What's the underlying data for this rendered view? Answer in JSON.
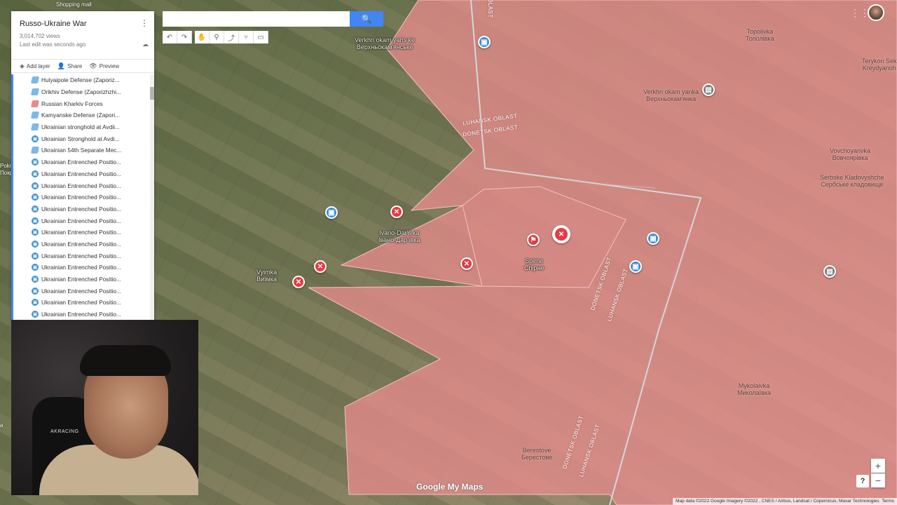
{
  "map": {
    "top_label": "Shopping mall",
    "places": [
      {
        "name": "Verkhn okam yans ke",
        "alt": "Верхньокам'янське"
      },
      {
        "name": "Verkhn okam yanka",
        "alt": "Верхньокам'янка"
      },
      {
        "name": "Topolivka",
        "alt": "Тополівка"
      },
      {
        "name": "Terykon Sek",
        "alt": "Kreydyanoh"
      },
      {
        "name": "Vovchoyarivka",
        "alt": "Вовчоярівка"
      },
      {
        "name": "Serbske Kladovyshche",
        "alt": "Сербське кладовище"
      },
      {
        "name": "Ivano-Dar'ivka",
        "alt": "Івано-Дар'ївка"
      },
      {
        "name": "Spirne",
        "alt": "Спірне"
      },
      {
        "name": "Vyimka",
        "alt": "Виїмка"
      },
      {
        "name": "Mykolaivka",
        "alt": "Миколаївка"
      },
      {
        "name": "Berestove",
        "alt": "Берестове"
      }
    ],
    "oblasts": {
      "luhansk": "LUHANSK OBLAST",
      "donetsk": "DONETSK OBLAST",
      "obl_short": "OBLAST"
    },
    "left_edge": {
      "a": "Pokr",
      "b": "Покр",
      "c": "a"
    },
    "colors": {
      "occupied": "#e58c8c",
      "border": "#d9dde2",
      "marker_red": "#e23d44",
      "marker_blue": "#3a8fd1"
    }
  },
  "search": {
    "placeholder": "",
    "button_icon": "search-icon"
  },
  "toolbar": {
    "tools": [
      "undo",
      "redo",
      "hand",
      "marker",
      "line",
      "route",
      "ruler"
    ]
  },
  "panel": {
    "title": "Russo-Ukraine War",
    "views": "3,014,702 views",
    "last_edit": "Last edit was seconds ago",
    "actions": {
      "add_layer": "Add layer",
      "share": "Share",
      "preview": "Preview"
    },
    "items": [
      {
        "label": "Hulyaipole Defense (Zaporiz...",
        "icon": "poly-b"
      },
      {
        "label": "Orikhiv Defense (Zaporizhzhi...",
        "icon": "poly-b"
      },
      {
        "label": "Russian Kharkiv Forces",
        "icon": "poly-r"
      },
      {
        "label": "Kamyanske Defense (Zapori...",
        "icon": "poly-b"
      },
      {
        "label": "Ukrainian stronghold at Avdii...",
        "icon": "poly-b"
      },
      {
        "label": "Ukrainian Stronghold at Avdi...",
        "icon": "blue"
      },
      {
        "label": "Ukrainian 54th Separate Mec...",
        "icon": "poly-b"
      },
      {
        "label": "Ukrainian Entrenched Positio...",
        "icon": "blue"
      },
      {
        "label": "Ukrainian Entrenched Positio...",
        "icon": "blue"
      },
      {
        "label": "Ukrainian Entrenched Positio...",
        "icon": "blue"
      },
      {
        "label": "Ukrainian Entrenched Positio...",
        "icon": "blue"
      },
      {
        "label": "Ukrainian Entrenched Positio...",
        "icon": "blue"
      },
      {
        "label": "Ukrainian Entrenched Positio...",
        "icon": "blue"
      },
      {
        "label": "Ukrainian Entrenched Positio...",
        "icon": "blue"
      },
      {
        "label": "Ukrainian Entrenched Positio...",
        "icon": "blue"
      },
      {
        "label": "Ukrainian Entrenched Positio...",
        "icon": "blue"
      },
      {
        "label": "Ukrainian Entrenched Positio...",
        "icon": "blue"
      },
      {
        "label": "Ukrainian Entrenched Positio...",
        "icon": "blue"
      },
      {
        "label": "Ukrainian Entrenched Positio...",
        "icon": "blue"
      },
      {
        "label": "Ukrainian Entrenched Positio...",
        "icon": "blue"
      },
      {
        "label": "Ukrainian Entrenched Positio...",
        "icon": "blue"
      }
    ]
  },
  "webcam": {
    "chair_brand": "AKRACING"
  },
  "controls": {
    "zoom_in": "+",
    "zoom_out": "−",
    "help": "?"
  },
  "attribution": "Map data ©2022 Google Imagery ©2022 , CNES / Airbus, Landsat / Copernicus, Maxar Technologies",
  "terms": "Terms",
  "logo": "Google My Maps"
}
